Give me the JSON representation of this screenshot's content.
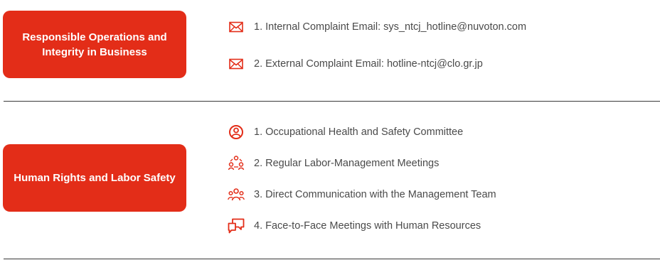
{
  "sections": [
    {
      "category": "Responsible Operations and Integrity in Business",
      "items": [
        {
          "icon": "mail-icon",
          "text": "1. Internal Complaint Email: sys_ntcj_hotline@nuvoton.com"
        },
        {
          "icon": "mail-icon",
          "text": "2. External Complaint Email: hotline-ntcj@clo.gr.jp"
        }
      ]
    },
    {
      "category": "Human Rights and Labor Safety",
      "items": [
        {
          "icon": "safety-person-icon",
          "text": "1. Occupational Health and Safety Committee"
        },
        {
          "icon": "meeting-group-icon",
          "text": "2. Regular Labor-Management Meetings"
        },
        {
          "icon": "team-icon",
          "text": "3. Direct Communication with the Management Team"
        },
        {
          "icon": "chat-bubbles-icon",
          "text": "4. Face-to-Face Meetings with Human Resources"
        }
      ]
    }
  ],
  "colors": {
    "accent": "#e32d18",
    "text": "#4a4a4a",
    "divider": "#3a3a3a"
  }
}
